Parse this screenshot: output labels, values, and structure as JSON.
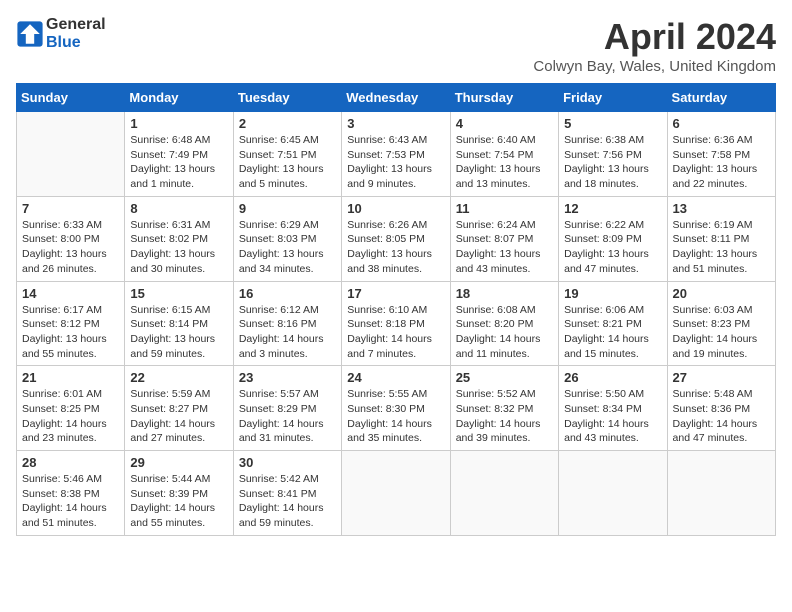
{
  "logo": {
    "text_general": "General",
    "text_blue": "Blue"
  },
  "header": {
    "title": "April 2024",
    "subtitle": "Colwyn Bay, Wales, United Kingdom"
  },
  "days_of_week": [
    "Sunday",
    "Monday",
    "Tuesday",
    "Wednesday",
    "Thursday",
    "Friday",
    "Saturday"
  ],
  "weeks": [
    [
      {
        "day": "",
        "info": ""
      },
      {
        "day": "1",
        "info": "Sunrise: 6:48 AM\nSunset: 7:49 PM\nDaylight: 13 hours and 1 minute."
      },
      {
        "day": "2",
        "info": "Sunrise: 6:45 AM\nSunset: 7:51 PM\nDaylight: 13 hours and 5 minutes."
      },
      {
        "day": "3",
        "info": "Sunrise: 6:43 AM\nSunset: 7:53 PM\nDaylight: 13 hours and 9 minutes."
      },
      {
        "day": "4",
        "info": "Sunrise: 6:40 AM\nSunset: 7:54 PM\nDaylight: 13 hours and 13 minutes."
      },
      {
        "day": "5",
        "info": "Sunrise: 6:38 AM\nSunset: 7:56 PM\nDaylight: 13 hours and 18 minutes."
      },
      {
        "day": "6",
        "info": "Sunrise: 6:36 AM\nSunset: 7:58 PM\nDaylight: 13 hours and 22 minutes."
      }
    ],
    [
      {
        "day": "7",
        "info": "Sunrise: 6:33 AM\nSunset: 8:00 PM\nDaylight: 13 hours and 26 minutes."
      },
      {
        "day": "8",
        "info": "Sunrise: 6:31 AM\nSunset: 8:02 PM\nDaylight: 13 hours and 30 minutes."
      },
      {
        "day": "9",
        "info": "Sunrise: 6:29 AM\nSunset: 8:03 PM\nDaylight: 13 hours and 34 minutes."
      },
      {
        "day": "10",
        "info": "Sunrise: 6:26 AM\nSunset: 8:05 PM\nDaylight: 13 hours and 38 minutes."
      },
      {
        "day": "11",
        "info": "Sunrise: 6:24 AM\nSunset: 8:07 PM\nDaylight: 13 hours and 43 minutes."
      },
      {
        "day": "12",
        "info": "Sunrise: 6:22 AM\nSunset: 8:09 PM\nDaylight: 13 hours and 47 minutes."
      },
      {
        "day": "13",
        "info": "Sunrise: 6:19 AM\nSunset: 8:11 PM\nDaylight: 13 hours and 51 minutes."
      }
    ],
    [
      {
        "day": "14",
        "info": "Sunrise: 6:17 AM\nSunset: 8:12 PM\nDaylight: 13 hours and 55 minutes."
      },
      {
        "day": "15",
        "info": "Sunrise: 6:15 AM\nSunset: 8:14 PM\nDaylight: 13 hours and 59 minutes."
      },
      {
        "day": "16",
        "info": "Sunrise: 6:12 AM\nSunset: 8:16 PM\nDaylight: 14 hours and 3 minutes."
      },
      {
        "day": "17",
        "info": "Sunrise: 6:10 AM\nSunset: 8:18 PM\nDaylight: 14 hours and 7 minutes."
      },
      {
        "day": "18",
        "info": "Sunrise: 6:08 AM\nSunset: 8:20 PM\nDaylight: 14 hours and 11 minutes."
      },
      {
        "day": "19",
        "info": "Sunrise: 6:06 AM\nSunset: 8:21 PM\nDaylight: 14 hours and 15 minutes."
      },
      {
        "day": "20",
        "info": "Sunrise: 6:03 AM\nSunset: 8:23 PM\nDaylight: 14 hours and 19 minutes."
      }
    ],
    [
      {
        "day": "21",
        "info": "Sunrise: 6:01 AM\nSunset: 8:25 PM\nDaylight: 14 hours and 23 minutes."
      },
      {
        "day": "22",
        "info": "Sunrise: 5:59 AM\nSunset: 8:27 PM\nDaylight: 14 hours and 27 minutes."
      },
      {
        "day": "23",
        "info": "Sunrise: 5:57 AM\nSunset: 8:29 PM\nDaylight: 14 hours and 31 minutes."
      },
      {
        "day": "24",
        "info": "Sunrise: 5:55 AM\nSunset: 8:30 PM\nDaylight: 14 hours and 35 minutes."
      },
      {
        "day": "25",
        "info": "Sunrise: 5:52 AM\nSunset: 8:32 PM\nDaylight: 14 hours and 39 minutes."
      },
      {
        "day": "26",
        "info": "Sunrise: 5:50 AM\nSunset: 8:34 PM\nDaylight: 14 hours and 43 minutes."
      },
      {
        "day": "27",
        "info": "Sunrise: 5:48 AM\nSunset: 8:36 PM\nDaylight: 14 hours and 47 minutes."
      }
    ],
    [
      {
        "day": "28",
        "info": "Sunrise: 5:46 AM\nSunset: 8:38 PM\nDaylight: 14 hours and 51 minutes."
      },
      {
        "day": "29",
        "info": "Sunrise: 5:44 AM\nSunset: 8:39 PM\nDaylight: 14 hours and 55 minutes."
      },
      {
        "day": "30",
        "info": "Sunrise: 5:42 AM\nSunset: 8:41 PM\nDaylight: 14 hours and 59 minutes."
      },
      {
        "day": "",
        "info": ""
      },
      {
        "day": "",
        "info": ""
      },
      {
        "day": "",
        "info": ""
      },
      {
        "day": "",
        "info": ""
      }
    ]
  ]
}
